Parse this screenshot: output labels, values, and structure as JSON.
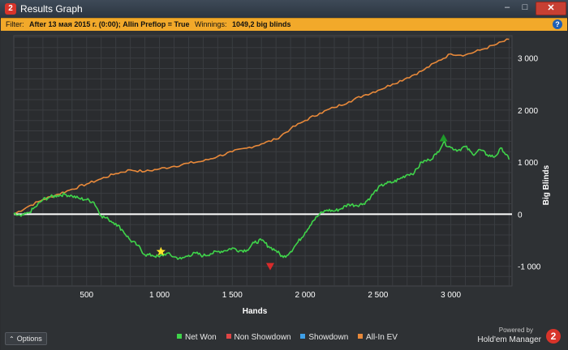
{
  "window": {
    "app_icon": "2",
    "title": "Results Graph",
    "minimize_glyph": "–",
    "maximize_glyph": "□",
    "close_glyph": "✕"
  },
  "filter": {
    "label": "Filter:",
    "value": "After 13 мая 2015 г. (0:00); Allin Preflop = True",
    "winnings_label": "Winnings:",
    "winnings_value": "1049,2 big blinds",
    "help_icon": "?"
  },
  "chart_data": {
    "type": "line",
    "xlabel": "Hands",
    "ylabel": "Big Blinds",
    "xlim": [
      0,
      3420
    ],
    "ylim": [
      -1380,
      3430
    ],
    "x_ticks": [
      500,
      1000,
      1500,
      2000,
      2500,
      3000
    ],
    "x_tick_labels": [
      "500",
      "1 000",
      "1 500",
      "2 000",
      "2 500",
      "3 000"
    ],
    "y_ticks": [
      3000,
      2000,
      1000,
      0,
      -1000
    ],
    "y_tick_labels": [
      "3 000",
      "2 000",
      "1 000",
      "0",
      "-1 000"
    ],
    "grid": true,
    "legend_position": "bottom",
    "series": [
      {
        "name": "All-In EV",
        "color": "#e8893a",
        "x": [
          0,
          100,
          200,
          300,
          400,
          500,
          600,
          700,
          800,
          900,
          1000,
          1100,
          1200,
          1300,
          1400,
          1500,
          1600,
          1700,
          1800,
          1900,
          2000,
          2100,
          2200,
          2300,
          2400,
          2500,
          2600,
          2700,
          2800,
          2900,
          3000,
          3100,
          3200,
          3300,
          3400
        ],
        "values": [
          0,
          150,
          280,
          380,
          480,
          580,
          680,
          780,
          850,
          820,
          870,
          920,
          980,
          1020,
          1110,
          1200,
          1270,
          1350,
          1440,
          1640,
          1800,
          1940,
          2050,
          2160,
          2280,
          2380,
          2500,
          2620,
          2750,
          2920,
          3080,
          3060,
          3150,
          3250,
          3360
        ]
      },
      {
        "name": "Net Won",
        "color": "#3fd44a",
        "x": [
          0,
          50,
          100,
          150,
          200,
          250,
          300,
          350,
          400,
          450,
          500,
          550,
          600,
          650,
          700,
          750,
          800,
          850,
          900,
          950,
          1000,
          1050,
          1100,
          1150,
          1200,
          1250,
          1300,
          1350,
          1400,
          1450,
          1500,
          1550,
          1600,
          1650,
          1700,
          1750,
          1800,
          1850,
          1900,
          1950,
          2000,
          2050,
          2100,
          2150,
          2200,
          2250,
          2300,
          2350,
          2400,
          2450,
          2500,
          2550,
          2600,
          2650,
          2700,
          2750,
          2800,
          2850,
          2900,
          2950,
          3000,
          3050,
          3100,
          3150,
          3200,
          3250,
          3300,
          3350,
          3400
        ],
        "values": [
          0,
          -40,
          20,
          140,
          280,
          330,
          360,
          380,
          350,
          300,
          280,
          230,
          -30,
          -100,
          -180,
          -320,
          -500,
          -600,
          -780,
          -790,
          -820,
          -750,
          -820,
          -860,
          -790,
          -750,
          -800,
          -760,
          -720,
          -700,
          -650,
          -700,
          -690,
          -550,
          -500,
          -620,
          -700,
          -830,
          -720,
          -540,
          -350,
          -140,
          0,
          80,
          60,
          110,
          190,
          170,
          200,
          330,
          500,
          590,
          610,
          680,
          760,
          800,
          1000,
          1040,
          1150,
          1380,
          1280,
          1230,
          1300,
          1150,
          1240,
          1140,
          1100,
          1270,
          1050
        ]
      },
      {
        "name": "Non Showdown",
        "color": "#e04545",
        "x": [],
        "values": []
      },
      {
        "name": "Showdown",
        "color": "#3fa0e8",
        "x": [],
        "values": []
      }
    ],
    "markers": [
      {
        "type": "star",
        "color": "#ffe52a",
        "x": 1010,
        "y": -720
      },
      {
        "type": "triangle-down",
        "color": "#d82b2b",
        "x": 1760,
        "y": -1000
      },
      {
        "type": "triangle-up",
        "color": "#1f9a2a",
        "x": 2950,
        "y": 1460
      }
    ]
  },
  "bottom": {
    "options_label": "Options",
    "options_glyph": "⌃",
    "legend": [
      {
        "label": "Net Won",
        "color": "#3fd44a"
      },
      {
        "label": "Non Showdown",
        "color": "#e04545"
      },
      {
        "label": "Showdown",
        "color": "#3fa0e8"
      },
      {
        "label": "All-In EV",
        "color": "#e8893a"
      }
    ],
    "brand_small": "Powered by",
    "brand_name": "Hold'em Manager",
    "brand_badge": "2"
  }
}
